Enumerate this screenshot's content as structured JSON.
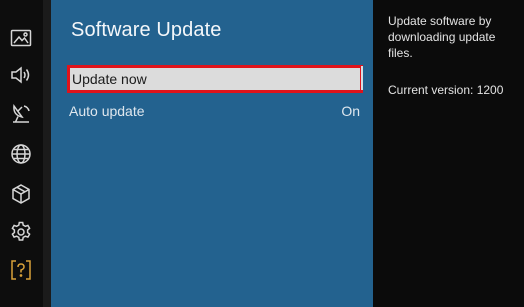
{
  "sidebar": {
    "items": [
      {
        "icon": "picture-icon"
      },
      {
        "icon": "sound-icon"
      },
      {
        "icon": "broadcasting-icon"
      },
      {
        "icon": "network-icon"
      },
      {
        "icon": "general-icon"
      },
      {
        "icon": "settings-icon"
      },
      {
        "icon": "support-icon",
        "active": true,
        "color": "#d9a23a"
      }
    ]
  },
  "panel": {
    "title": "Software Update",
    "items": [
      {
        "label": "Update now",
        "value": ""
      },
      {
        "label": "Auto update",
        "value": "On"
      }
    ],
    "background": "#23628f",
    "highlight_border": "#e0131b"
  },
  "info": {
    "description": "Update software by downloading update files.",
    "version": "Current version: 1200"
  }
}
